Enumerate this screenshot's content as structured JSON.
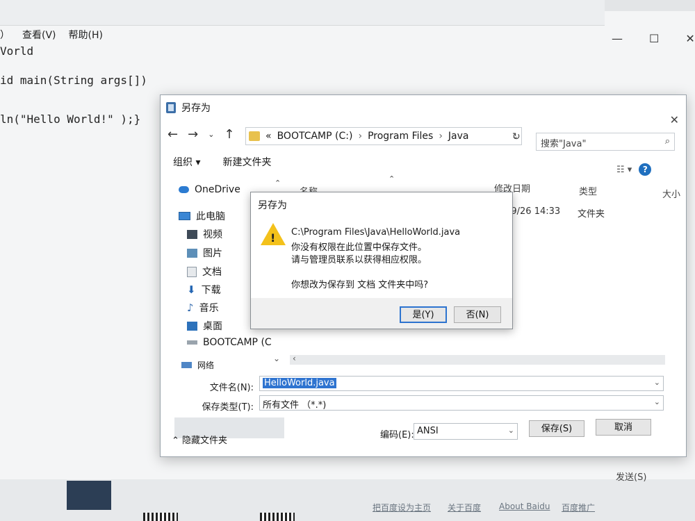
{
  "notepad": {
    "menu": [
      "）",
      "查看(V)",
      "帮助(H)"
    ],
    "window_controls": [
      "—",
      "☐",
      "✕"
    ],
    "code_lines": [
      "Vorld",
      "id main(String args[])",
      "ln(\"Hello World!\" );}"
    ]
  },
  "save_dialog": {
    "title": "另存为",
    "close": "✕",
    "nav": {
      "back": "←",
      "forward": "→",
      "recent": "⌄",
      "up": "↑"
    },
    "address": {
      "prefix": "«",
      "crumbs": [
        "BOOTCAMP (C:)",
        "Program Files",
        "Java"
      ],
      "separator": "›",
      "dropdown": "⌄",
      "refresh": "↻"
    },
    "search_placeholder": "搜索\"Java\"",
    "search_icon": "⌕",
    "toolbar": {
      "organize": "组织 ▾",
      "new_folder": "新建文件夹"
    },
    "view": {
      "layout": "☷ ▾",
      "help": "?"
    },
    "sidebar": [
      {
        "label": "OneDrive",
        "icon": "cloud-icon"
      },
      {
        "label": "此电脑",
        "icon": "computer-icon"
      },
      {
        "label": "视频",
        "icon": "video-icon"
      },
      {
        "label": "图片",
        "icon": "pictures-icon"
      },
      {
        "label": "文档",
        "icon": "documents-icon"
      },
      {
        "label": "下载",
        "icon": "download-icon"
      },
      {
        "label": "音乐",
        "icon": "music-icon"
      },
      {
        "label": "桌面",
        "icon": "desktop-icon"
      },
      {
        "label": "BOOTCAMP (C",
        "icon": "drive-icon"
      },
      {
        "label": "网络",
        "icon": "network-icon"
      }
    ],
    "columns": [
      "名称",
      "修改日期",
      "类型",
      "大小"
    ],
    "rows": [
      {
        "modified": "/9/26 14:33",
        "type": "文件夹"
      }
    ],
    "filename_label": "文件名(N):",
    "filename_value": "HelloWorld.java",
    "filetype_label": "保存类型(T):",
    "filetype_value": "所有文件 （*.*)",
    "hide_folders": "隐藏文件夹",
    "encoding_label": "编码(E):",
    "encoding_value": "ANSI",
    "save_button": "保存(S)",
    "cancel_button": "取消"
  },
  "warning_dialog": {
    "title": "另存为",
    "lines": [
      "C:\\Program Files\\Java\\HelloWorld.java",
      "你没有权限在此位置中保存文件。",
      "请与管理员联系以获得相应权限。",
      "你想改为保存到 文档 文件夹中吗?"
    ],
    "yes_button": "是(Y)",
    "no_button": "否(N)"
  },
  "background_page": {
    "send": "发送(S)",
    "links": [
      "把百度设为主页",
      "关于百度",
      "About  Baidu",
      "百度推广"
    ]
  },
  "colors": {
    "selection": "#2f74d0",
    "warning": "#f3c11b",
    "focus_border": "#2c73cf"
  }
}
